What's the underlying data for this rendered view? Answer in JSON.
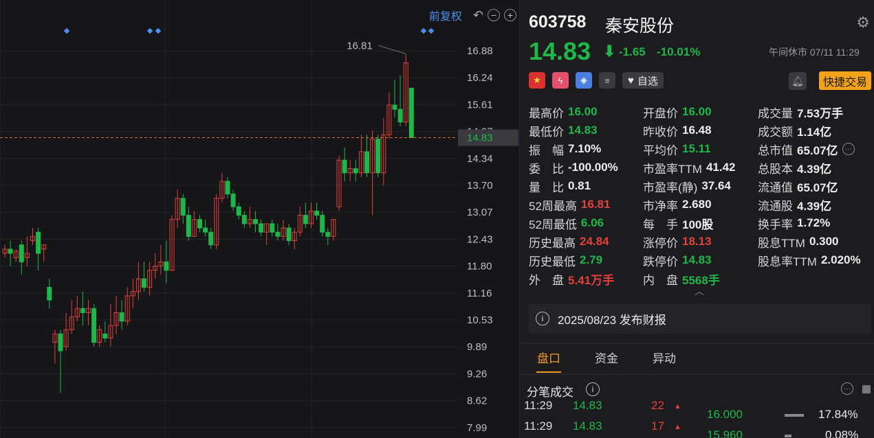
{
  "chart": {
    "adjust_label": "前复权",
    "price_ticks": [
      "16.88",
      "16.24",
      "15.61",
      "14.97",
      "14.34",
      "13.70",
      "13.07",
      "12.43",
      "11.80",
      "11.16",
      "10.53",
      "9.89",
      "9.26",
      "8.62",
      "7.99"
    ],
    "current_price_tag": "14.83",
    "high_annotation": "16.81",
    "colors": {
      "up": "#e2413c",
      "down": "#1fb64a",
      "price_line": "#e07030",
      "marker": "#4a8ef0"
    }
  },
  "header": {
    "code": "603758",
    "name": "秦安股份",
    "price": "14.83",
    "change": "-1.65",
    "change_pct": "-10.01%",
    "status": "午间休市 07/11 11:29"
  },
  "actions": {
    "watchlist_label": "自选",
    "trade_label": "快捷交易"
  },
  "stats": {
    "col1": [
      {
        "label": "最高价",
        "value": "16.00",
        "color": "g"
      },
      {
        "label": "最低价",
        "value": "14.83",
        "color": "g"
      },
      {
        "label": "振　幅",
        "value": "7.10%",
        "color": "w"
      },
      {
        "label": "委　比",
        "value": "-100.00%",
        "color": "w"
      },
      {
        "label": "量　比",
        "value": "0.81",
        "color": "w"
      },
      {
        "label": "52周最高",
        "value": "16.81",
        "color": "r"
      },
      {
        "label": "52周最低",
        "value": "6.06",
        "color": "g"
      },
      {
        "label": "历史最高",
        "value": "24.84",
        "color": "r"
      },
      {
        "label": "历史最低",
        "value": "2.79",
        "color": "g"
      },
      {
        "label": "外　盘",
        "value": "5.41万手",
        "color": "r"
      }
    ],
    "col2": [
      {
        "label": "开盘价",
        "value": "16.00",
        "color": "g"
      },
      {
        "label": "昨收价",
        "value": "16.48",
        "color": "w"
      },
      {
        "label": "平均价",
        "value": "15.11",
        "color": "g"
      },
      {
        "label": "市盈率TTM",
        "value": "41.42",
        "color": "w"
      },
      {
        "label": "市盈率(静)",
        "value": "37.64",
        "color": "w"
      },
      {
        "label": "市净率",
        "value": "2.680",
        "color": "w"
      },
      {
        "label": "每　手",
        "value": "100股",
        "color": "w"
      },
      {
        "label": "涨停价",
        "value": "18.13",
        "color": "r"
      },
      {
        "label": "跌停价",
        "value": "14.83",
        "color": "g"
      },
      {
        "label": "内　盘",
        "value": "5568手",
        "color": "g"
      }
    ],
    "col3": [
      {
        "label": "成交量",
        "value": "7.53万手",
        "color": "w"
      },
      {
        "label": "成交额",
        "value": "1.14亿",
        "color": "w"
      },
      {
        "label": "总市值",
        "value": "65.07亿",
        "color": "w"
      },
      {
        "label": "总股本",
        "value": "4.39亿",
        "color": "w"
      },
      {
        "label": "流通值",
        "value": "65.07亿",
        "color": "w"
      },
      {
        "label": "流通股",
        "value": "4.39亿",
        "color": "w"
      },
      {
        "label": "换手率",
        "value": "1.72%",
        "color": "w"
      },
      {
        "label": "股息TTM",
        "value": "0.300",
        "color": "w"
      },
      {
        "label": "股息率TTM",
        "value": "2.020%",
        "color": "w"
      }
    ]
  },
  "notice": {
    "text": "2025/08/23  发布财报"
  },
  "tabs": [
    "盘口",
    "资金",
    "异动"
  ],
  "ticks": {
    "title": "分笔成交",
    "rows": [
      {
        "time": "11:29",
        "price": "14.83",
        "vol": "22"
      },
      {
        "time": "11:29",
        "price": "14.83",
        "vol": "17"
      }
    ],
    "dist": [
      {
        "price": "16.000",
        "pct": "17.84%"
      },
      {
        "price": "15.960",
        "pct": "0.08%"
      }
    ]
  }
}
